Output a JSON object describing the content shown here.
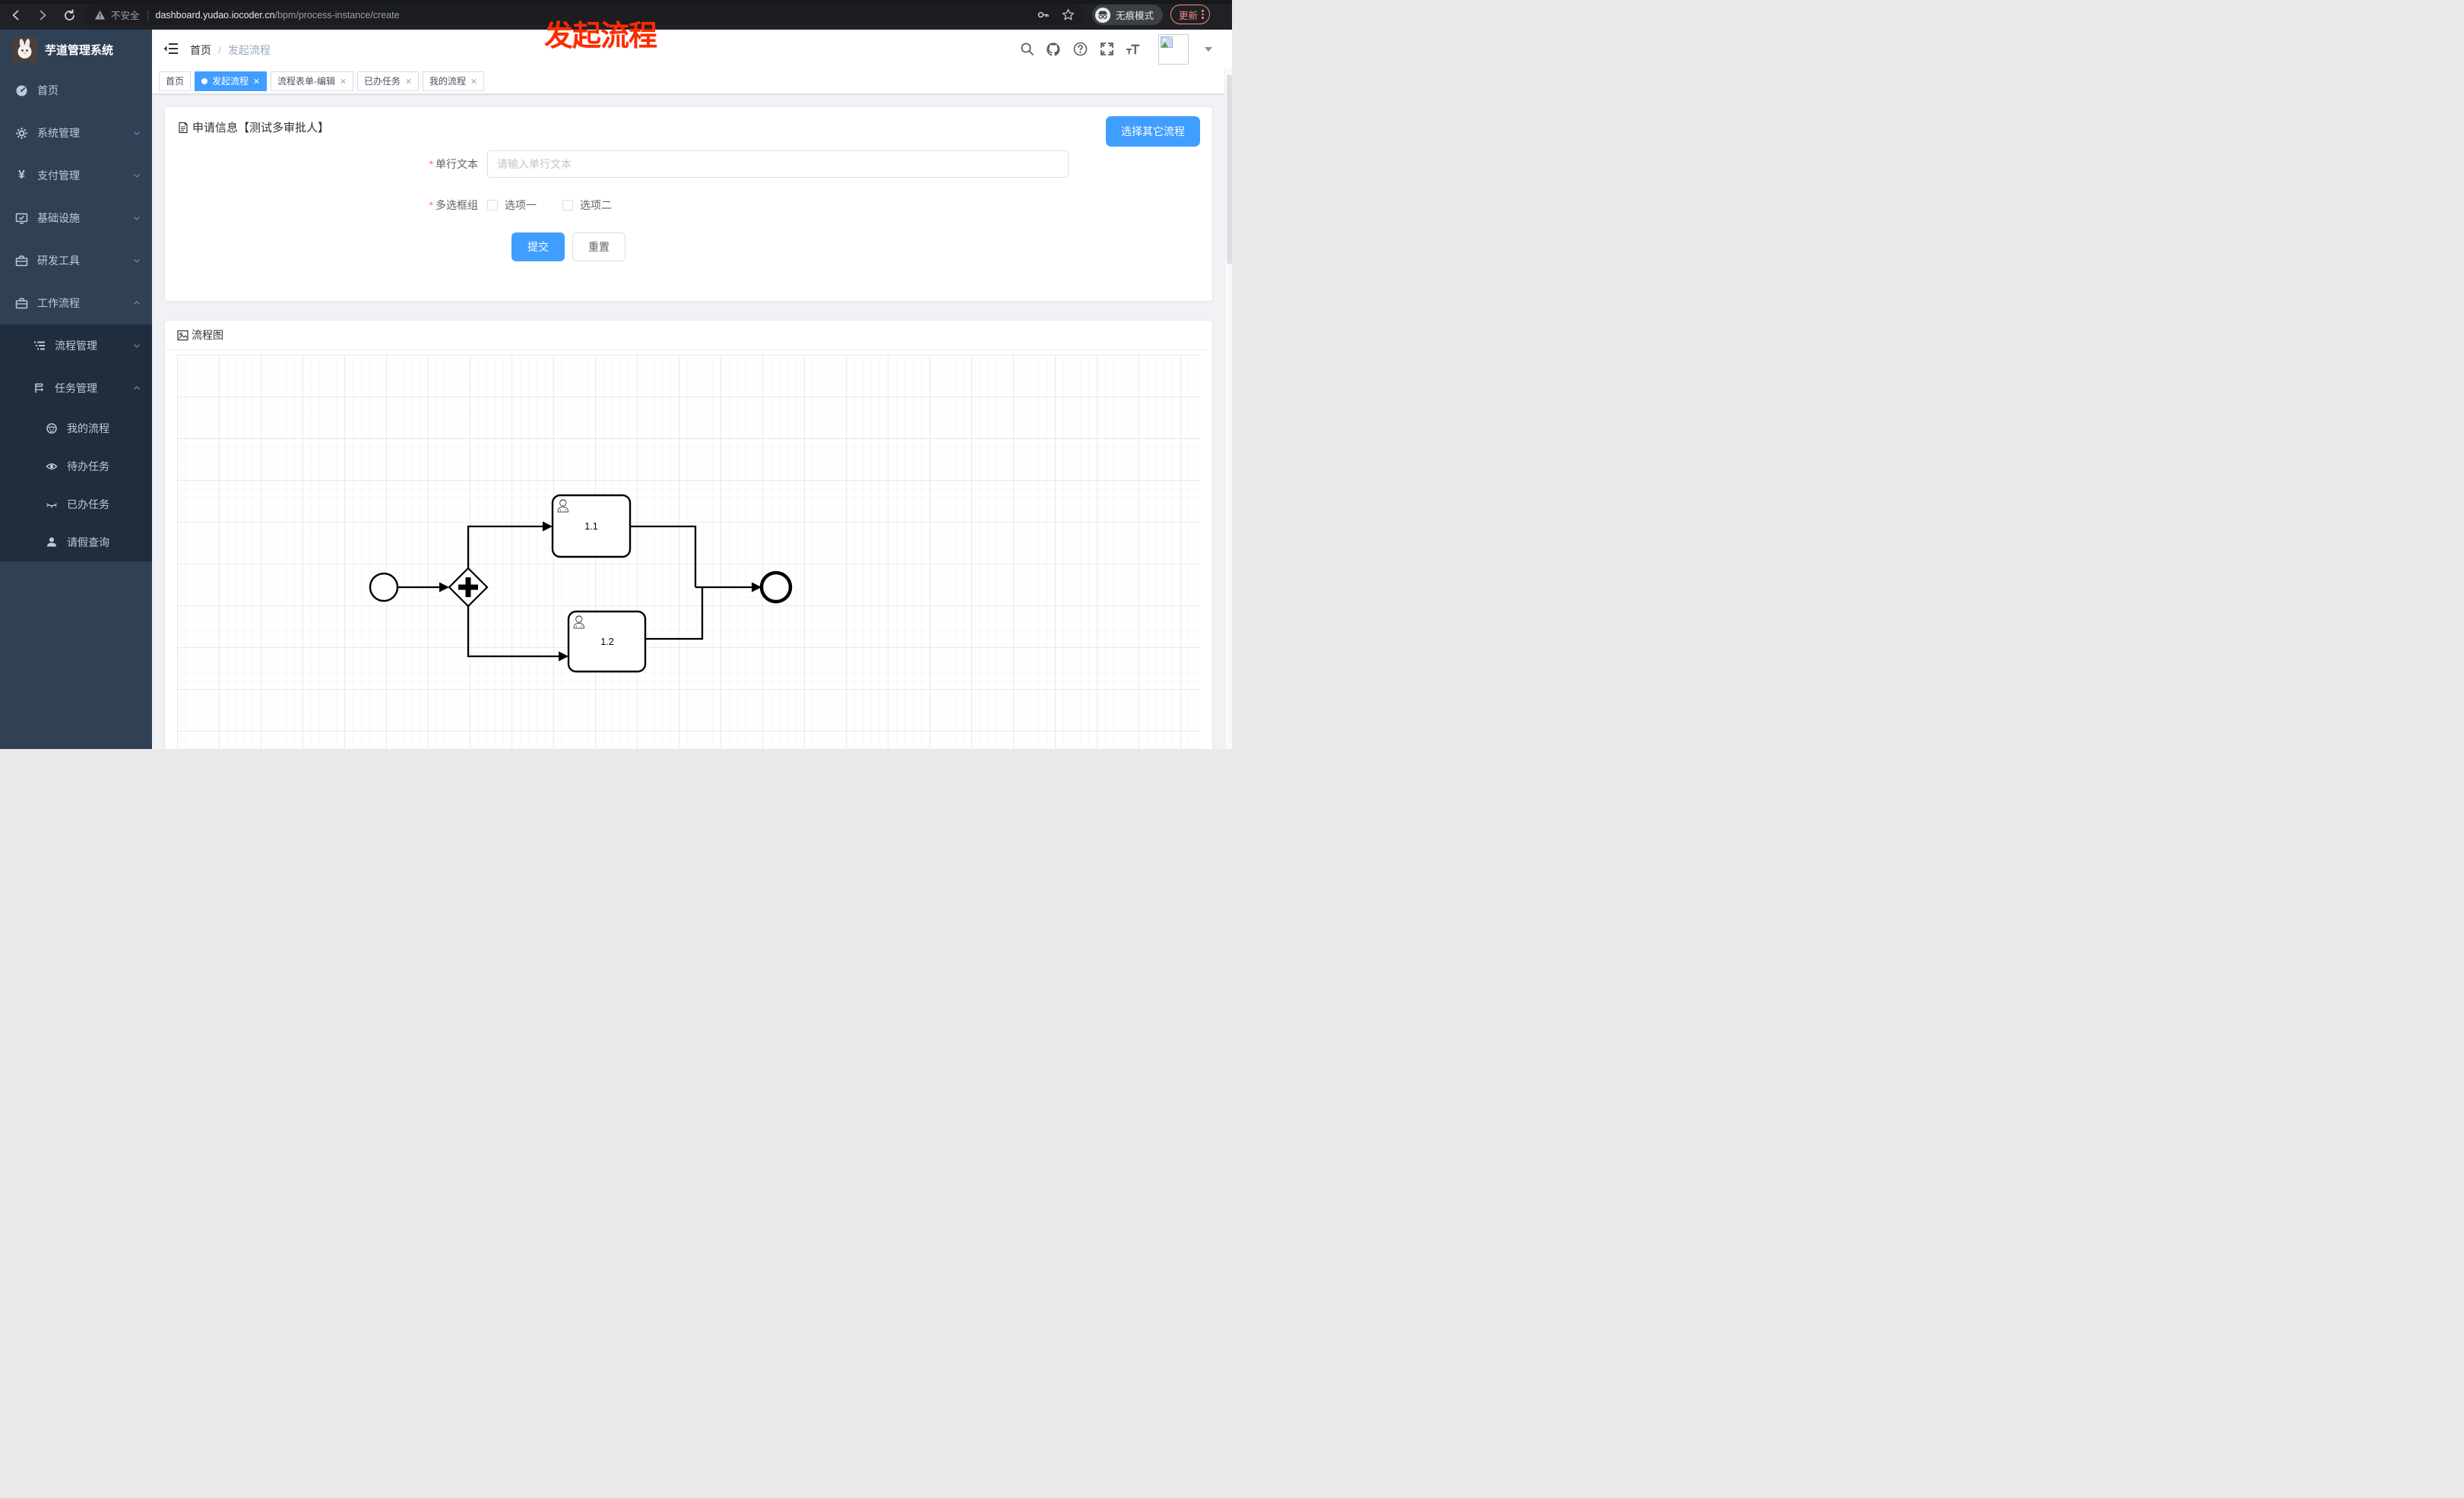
{
  "browser": {
    "security": "不安全",
    "host": "dashboard.yudao.iocoder.cn",
    "path": "/bpm/process-instance/create",
    "incognito": "无痕模式",
    "update": "更新"
  },
  "sidebar": {
    "title": "芋道管理系统",
    "items": [
      {
        "label": "首页"
      },
      {
        "label": "系统管理"
      },
      {
        "label": "支付管理"
      },
      {
        "label": "基础设施"
      },
      {
        "label": "研发工具"
      },
      {
        "label": "工作流程"
      }
    ],
    "groups": [
      {
        "label": "流程管理"
      },
      {
        "label": "任务管理"
      }
    ],
    "leaves": [
      {
        "label": "我的流程"
      },
      {
        "label": "待办任务"
      },
      {
        "label": "已办任务"
      },
      {
        "label": "请假查询"
      }
    ]
  },
  "header": {
    "breadcrumb_home": "首页",
    "breadcrumb_sep": "/",
    "breadcrumb_current": "发起流程"
  },
  "annotation": {
    "text": "发起流程"
  },
  "tabs": [
    {
      "label": "首页"
    },
    {
      "label": "发起流程"
    },
    {
      "label": "流程表单-编辑"
    },
    {
      "label": "已办任务"
    },
    {
      "label": "我的流程"
    }
  ],
  "apply_card": {
    "title": "申请信息【测试多审批人】",
    "choose_other": "选择其它流程",
    "required_mark": "*",
    "fields": [
      {
        "label": "单行文本",
        "placeholder": "请输入单行文本"
      },
      {
        "label": "多选框组",
        "options": [
          "选项一",
          "选项二"
        ]
      }
    ],
    "submit": "提交",
    "reset": "重置"
  },
  "diagram_card": {
    "title": "流程图",
    "nodes": {
      "task1": "1.1",
      "task2": "1.2"
    }
  },
  "colors": {
    "accent": "#409eff",
    "sidebar_bg": "#304156",
    "submenu_bg": "#1f2d3d",
    "annotation_red": "#ff2b00",
    "chrome_bg": "#202124"
  }
}
